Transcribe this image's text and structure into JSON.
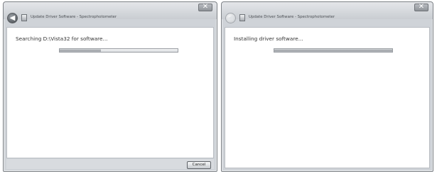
{
  "left_window": {
    "title": "Update Driver Software - Spectrophotometer",
    "close_label": "✕",
    "back_glyph": "◀",
    "status_text": "Searching D:\\Vista32 for software...",
    "progress": 0.35,
    "cancel_label": "Cancel",
    "icons": [
      "back-arrow-icon",
      "device-icon",
      "close-icon"
    ]
  },
  "right_window": {
    "title": "Update Driver Software - Spectrophotometer",
    "close_label": "✕",
    "back_glyph": "◀",
    "status_text": "Installing driver software...",
    "progress": 1.0,
    "icons": [
      "back-arrow-icon",
      "device-icon",
      "close-icon"
    ]
  }
}
